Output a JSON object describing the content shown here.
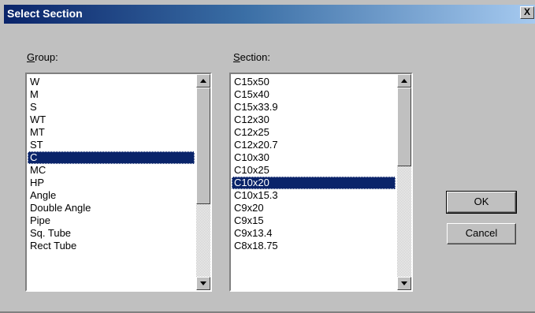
{
  "dialog": {
    "title": "Select Section",
    "close_label": "X"
  },
  "group": {
    "label_mnemonic": "G",
    "label_rest": "roup:",
    "items": [
      "W",
      "M",
      "S",
      "WT",
      "MT",
      "ST",
      "C",
      "MC",
      "HP",
      "Angle",
      "Double Angle",
      "Pipe",
      "Sq. Tube",
      "Rect Tube"
    ],
    "selected": "C"
  },
  "section": {
    "label_mnemonic": "S",
    "label_rest": "ection:",
    "items": [
      "C15x50",
      "C15x40",
      "C15x33.9",
      "C12x30",
      "C12x25",
      "C12x20.7",
      "C10x30",
      "C10x25",
      "C10x20",
      "C10x15.3",
      "C9x20",
      "C9x15",
      "C9x13.4",
      "C8x18.75"
    ],
    "selected": "C10x20"
  },
  "buttons": {
    "ok": "OK",
    "cancel": "Cancel"
  },
  "colors": {
    "selection": "#0a246a",
    "face": "#c0c0c0",
    "title_start": "#0a246a",
    "title_end": "#a6caf0"
  },
  "icons": {
    "close": "close-icon",
    "scroll_up": "arrow-up-icon",
    "scroll_down": "arrow-down-icon"
  }
}
